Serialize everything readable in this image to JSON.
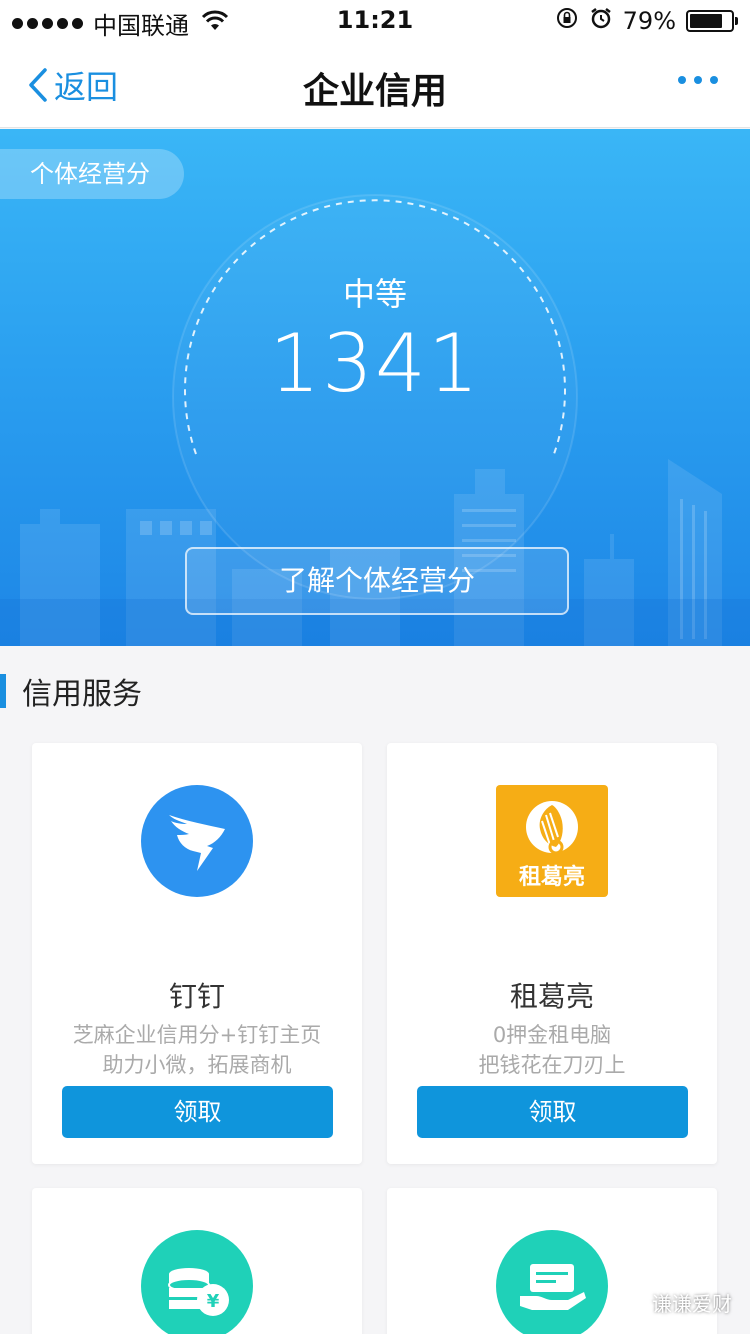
{
  "status_bar": {
    "carrier": "中国联通",
    "time": "11:21",
    "battery_percent": "79%",
    "battery_level": 0.79,
    "icons": [
      "signal-dots-icon",
      "wifi-icon",
      "rotation-lock-icon",
      "alarm-icon",
      "battery-icon"
    ]
  },
  "nav": {
    "back_label": "返回",
    "title": "企业信用",
    "more_icon": "more-dots-icon",
    "accent_color": "#1a8fe0"
  },
  "hero": {
    "tag": "个体经营分",
    "level": "中等",
    "score": "1341",
    "button_label": "了解个体经营分",
    "gradient": [
      "#3ab6f6",
      "#1d86e6"
    ]
  },
  "services": {
    "section_title": "信用服务",
    "button_color": "#0f95dc",
    "cards": [
      {
        "name": "钉钉",
        "desc_line1": "芝麻企业信用分+钉钉主页",
        "desc_line2": "助力小微，拓展商机",
        "button": "领取",
        "icon": "dingtalk-logo-icon"
      },
      {
        "name": "租葛亮",
        "desc_line1": "0押金租电脑",
        "desc_line2": "把钱花在刀刃上",
        "button": "领取",
        "icon": "zugeliang-logo-icon",
        "logo_text": "租葛亮"
      },
      {
        "icon": "coins-yen-icon"
      },
      {
        "icon": "card-in-hand-icon"
      }
    ]
  },
  "watermark": {
    "text": "谦谦爱财"
  }
}
